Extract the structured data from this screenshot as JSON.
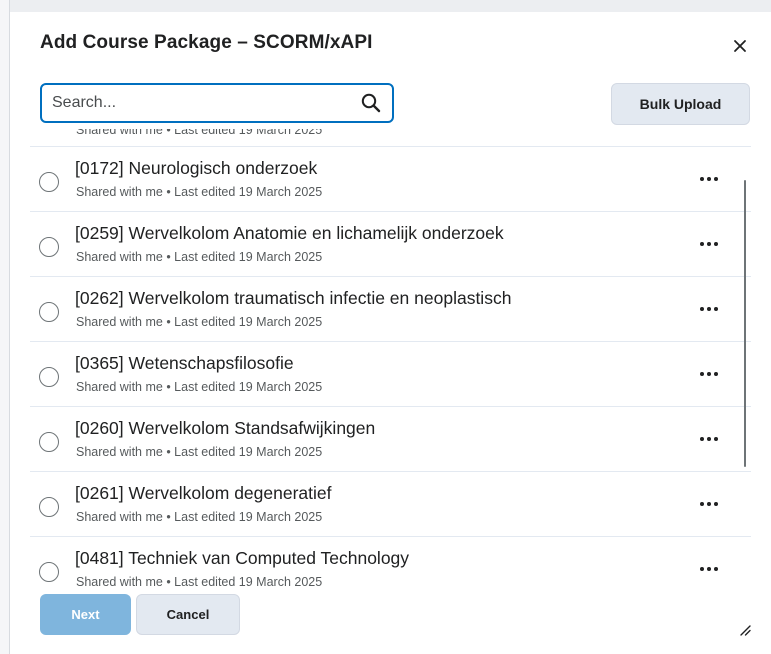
{
  "dialog": {
    "title": "Add Course Package – SCORM/xAPI",
    "close_icon": "close-icon"
  },
  "search": {
    "placeholder": "Search...",
    "value": "",
    "icon": "search-icon"
  },
  "toolbar": {
    "bulk_upload_label": "Bulk Upload"
  },
  "packages": {
    "partial_top": {
      "meta": "Shared with me • Last edited 19 March 2025"
    },
    "items": [
      {
        "title": "[0172] Neurologisch onderzoek",
        "meta": "Shared with me • Last edited 19 March 2025"
      },
      {
        "title": "[0259] Wervelkolom Anatomie en lichamelijk onderzoek",
        "meta": "Shared with me • Last edited 19 March 2025"
      },
      {
        "title": "[0262] Wervelkolom traumatisch infectie en neoplastisch",
        "meta": "Shared with me • Last edited 19 March 2025"
      },
      {
        "title": "[0365] Wetenschapsfilosofie",
        "meta": "Shared with me • Last edited 19 March 2025"
      },
      {
        "title": "[0260] Wervelkolom Standsafwijkingen",
        "meta": "Shared with me • Last edited 19 March 2025"
      },
      {
        "title": "[0261] Wervelkolom degeneratief",
        "meta": "Shared with me • Last edited 19 March 2025"
      },
      {
        "title": "[0481] Techniek van Computed Technology",
        "meta": "Shared with me • Last edited 19 March 2025"
      }
    ],
    "more_icon": "more-options-icon"
  },
  "footer": {
    "next_label": "Next",
    "cancel_label": "Cancel"
  },
  "colors": {
    "primary": "#006fbf",
    "primary_disabled": "#7fb5dd",
    "secondary_button": "#e3e9f1",
    "text": "#202122",
    "meta_text": "#565a5c"
  }
}
